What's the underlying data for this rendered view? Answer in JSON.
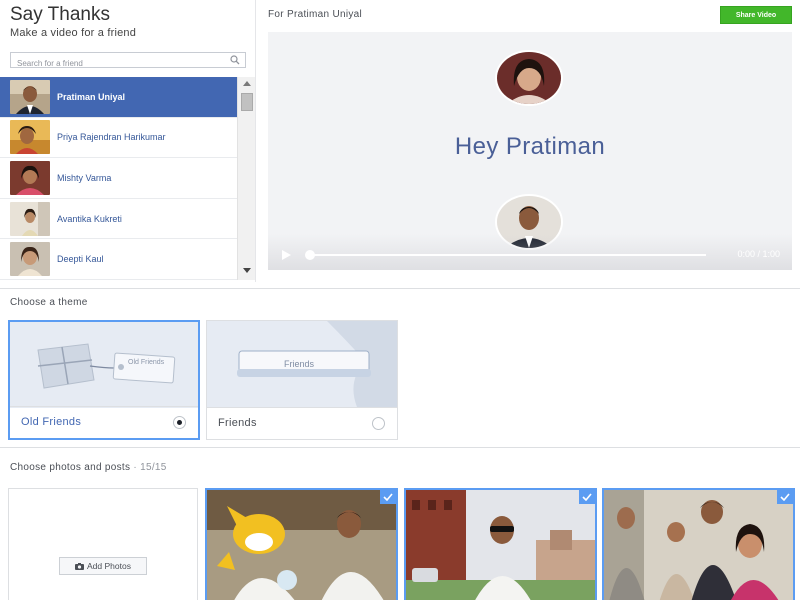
{
  "header": {
    "title": "Say Thanks",
    "subtitle": "Make a video for a friend"
  },
  "search": {
    "placeholder": "Search for a friend"
  },
  "friends": [
    {
      "name": "Pratiman Uniyal",
      "selected": true
    },
    {
      "name": "Priya Rajendran Harikumar",
      "selected": false
    },
    {
      "name": "Mishty Varma",
      "selected": false
    },
    {
      "name": "Avantika Kukreti",
      "selected": false
    },
    {
      "name": "Deepti Kaul",
      "selected": false
    }
  ],
  "preview": {
    "for_label": "For Pratiman Uniyal",
    "share_label": "Share Video",
    "greeting": "Hey Pratiman",
    "time": "0:00 / 1:00"
  },
  "themes": {
    "label": "Choose a theme",
    "items": [
      {
        "name": "Old Friends",
        "art_text": "Old Friends",
        "selected": true
      },
      {
        "name": "Friends",
        "art_text": "Friends",
        "selected": false
      }
    ]
  },
  "photos": {
    "label": "Choose photos and posts",
    "count": "· 15/15",
    "add_label": "Add Photos"
  },
  "colors": {
    "accent": "#4267b2",
    "share": "#42b72a",
    "selection": "#5b9cf2"
  }
}
